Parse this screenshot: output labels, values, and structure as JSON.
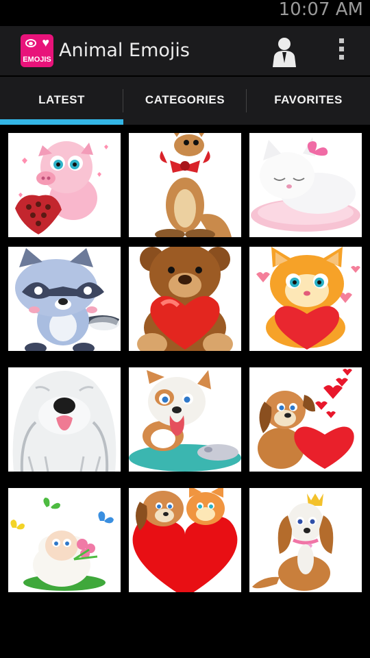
{
  "status_bar": {
    "time": "10:07 AM"
  },
  "app_bar": {
    "title": "Animal Emojis",
    "icon_text": "EMOJIS",
    "account_icon": "account-icon",
    "menu_icon": "overflow-menu-icon"
  },
  "tabs": [
    {
      "label": "LATEST",
      "selected": true
    },
    {
      "label": "CATEGORIES",
      "selected": false
    },
    {
      "label": "FAVORITES",
      "selected": false
    }
  ],
  "colors": {
    "accent": "#33b5e5",
    "bar": "#1b1b1d",
    "app_icon": "#e8137a",
    "background": "#000000"
  },
  "grid_items": [
    {
      "icon": "pig-with-heart-chocolates"
    },
    {
      "icon": "kangaroo-with-bow"
    },
    {
      "icon": "sleeping-white-kitten"
    },
    {
      "icon": "raccoon"
    },
    {
      "icon": "teddy-bear-with-heart"
    },
    {
      "icon": "kitten-with-heart"
    },
    {
      "icon": "sheepdog"
    },
    {
      "icon": "puppy-with-mouse"
    },
    {
      "icon": "puppy-with-heart-balloons"
    },
    {
      "icon": "sheep-with-butterflies"
    },
    {
      "icon": "puppy-and-kitten-on-heart"
    },
    {
      "icon": "spaniel-with-crown"
    }
  ]
}
